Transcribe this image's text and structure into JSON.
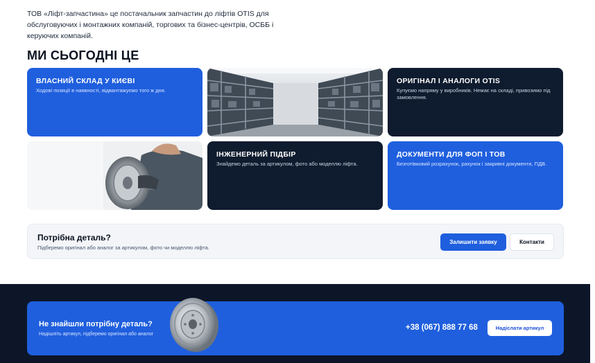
{
  "intro": {
    "text": "ТОВ «Ліфт-запчастина» це постачальник запчастин до ліфтів OTIS для обслуговуючих і монтажних компаній, торгових та бізнес-центрів, ОСББ і керуючих компаній."
  },
  "section": {
    "title": "МИ СЬОГОДНІ ЦЕ"
  },
  "cards": {
    "warehouse": {
      "title": "ВЛАСНИЙ СКЛАД У КИЄВІ",
      "text": "Ходові позиції в наявності, відвантажуємо того ж дня."
    },
    "original": {
      "title": "ОРИГІНАЛ І АНАЛОГИ OTIS",
      "text": "Купуємо напряму у виробників. Немає на складі, привозимо під замовлення."
    },
    "engineering": {
      "title": "ІНЖЕНЕРНИЙ ПІДБІР",
      "text": "Знайдемо деталь за артикулом, фото або моделлю ліфта."
    },
    "documents": {
      "title": "ДОКУМЕНТИ ДЛЯ ФОП І ТОВ",
      "text": "Безготівковий розрахунок, рахунок і закривні документи, ПДВ."
    }
  },
  "cta": {
    "title": "Потрібна деталь?",
    "subtitle": "Підберемо оригінал або аналог за артикулом, фото чи моделлю ліфта.",
    "primary_label": "Залишити заявку",
    "secondary_label": "Контакти"
  },
  "footer_banner": {
    "title": "Не знайшли потрібну деталь?",
    "subtitle": "Надішліть артикул, підберемо оригінал або аналог",
    "phone": "+38 (067) 888 77 68",
    "button_label": "Надіслати артикул"
  },
  "colors": {
    "accent": "#1f5fde",
    "dark": "#0f1b2e",
    "footer": "#0d1628",
    "panel": "#f3f5f9"
  },
  "icons": {
    "photo1": "warehouse-photo",
    "photo2": "worker-with-pulley-photo",
    "banner": "pulley-wheel-image"
  }
}
